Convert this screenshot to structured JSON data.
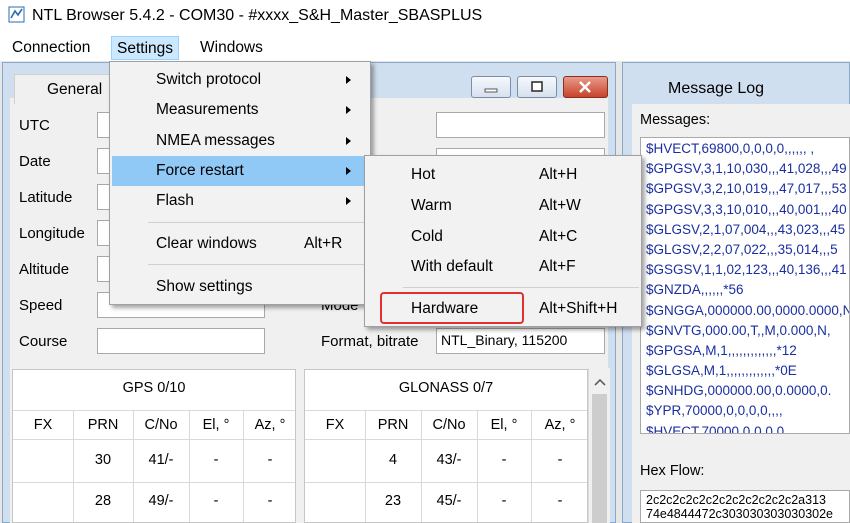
{
  "window": {
    "title": "NTL Browser 5.4.2 - COM30 - #xxxx_S&H_Master_SBASPLUS"
  },
  "menubar": {
    "items": [
      "Connection",
      "Settings",
      "Windows"
    ]
  },
  "general_window": {
    "tab": "General",
    "labels": {
      "utc": "UTC",
      "date": "Date",
      "latitude": "Latitude",
      "longitude": "Longitude",
      "altitude": "Altitude",
      "speed": "Speed",
      "course": "Course",
      "mode": "Mode",
      "format_bitrate": "Format, bitrate"
    },
    "format_bitrate_value": "NTL_Binary, 115200",
    "gps": {
      "title": "GPS  0/10",
      "columns": [
        "FX",
        "PRN",
        "C/No",
        "El, °",
        "Az, °"
      ],
      "rows": [
        {
          "fx": "",
          "prn": "30",
          "cno": "41/-",
          "el": "-",
          "az": "-"
        },
        {
          "fx": "",
          "prn": "28",
          "cno": "49/-",
          "el": "-",
          "az": "-"
        }
      ]
    },
    "glonass": {
      "title": "GLONASS  0/7",
      "columns": [
        "FX",
        "PRN",
        "C/No",
        "El, °",
        "Az, °"
      ],
      "rows": [
        {
          "fx": "",
          "prn": "4",
          "cno": "43/-",
          "el": "-",
          "az": "-"
        },
        {
          "fx": "",
          "prn": "23",
          "cno": "45/-",
          "el": "-",
          "az": "-"
        }
      ]
    }
  },
  "message_log": {
    "title": "Message Log",
    "messages_label": "Messages:",
    "messages": [
      "$HVECT,69800,0,0,0,0,,,,,, ,",
      "$GPGSV,3,1,10,030,,,41,028,,,49",
      "$GPGSV,3,2,10,019,,,47,017,,,53",
      "$GPGSV,3,3,10,010,,,40,001,,,40",
      "$GLGSV,2,1,07,004,,,43,023,,,45",
      "$GLGSV,2,2,07,022,,,35,014,,,5",
      "$GSGSV,1,1,02,123,,,40,136,,,41",
      "$GNZDA,,,,,,*56",
      "$GNGGA,000000.00,0000.0000,N,",
      "$GNVTG,000.00,T,,M,0.000,N,",
      "$GPGSA,M,1,,,,,,,,,,,,,*12",
      "$GLGSA,M,1,,,,,,,,,,,,,*0E",
      "$GNHDG,000000.00,0.0000,0.",
      "$YPR,70000,0,0,0,0,,,,",
      "$HVECT,70000,0,0,0,0,,,,,, ,"
    ],
    "hex_label": "Hex Flow:",
    "hex_lines": [
      "2c2c2c2c2c2c2c2c2c2c2c2a313",
      "74e4844472c303030303030302e"
    ]
  },
  "settings_menu": {
    "items": [
      {
        "label": "Switch protocol",
        "submenu": true,
        "shortcut": ""
      },
      {
        "label": "Measurements",
        "submenu": true,
        "shortcut": ""
      },
      {
        "label": "NMEA messages",
        "submenu": true,
        "shortcut": ""
      },
      {
        "label": "Force restart",
        "submenu": true,
        "shortcut": ""
      },
      {
        "label": "Flash",
        "submenu": true,
        "shortcut": ""
      },
      {
        "label": "Clear windows",
        "submenu": false,
        "shortcut": "Alt+R"
      },
      {
        "label": "Show settings",
        "submenu": false,
        "shortcut": ""
      }
    ]
  },
  "force_restart_menu": {
    "items": [
      {
        "label": "Hot",
        "shortcut": "Alt+H"
      },
      {
        "label": "Warm",
        "shortcut": "Alt+W"
      },
      {
        "label": "Cold",
        "shortcut": "Alt+C"
      },
      {
        "label": "With default",
        "shortcut": "Alt+F"
      },
      {
        "label": "Hardware",
        "shortcut": "Alt+Shift+H"
      }
    ]
  },
  "colors": {
    "menu_highlight": "#90c8f6",
    "message_text": "#1a2fa0",
    "annotation_red": "#e03030"
  }
}
